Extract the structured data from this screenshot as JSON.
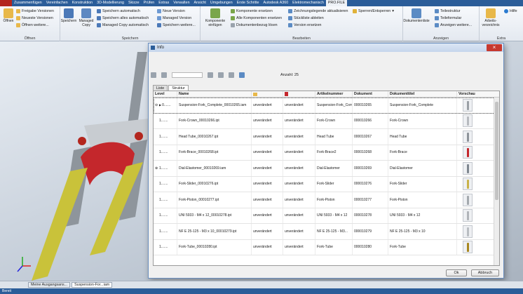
{
  "ribbon_tabs": [
    "Zusammenfügen",
    "Vereinfachen",
    "Konstruktion",
    "3D-Modellierung",
    "Skizze",
    "Prüfen",
    "Extras",
    "Verwalten",
    "Ansicht",
    "Umgebungen",
    "Erste Schritte",
    "Autodesk A360",
    "Elektromechanisch",
    "PRO.FILE"
  ],
  "active_tab_index": 13,
  "groups": {
    "oeffnen": {
      "label": "Öffnen",
      "big": "Öffnen",
      "small": [
        "Freigabe Versionen",
        "Neueste Versionen",
        "Öffnen weitere..."
      ]
    },
    "speichern": {
      "label": "Speichern",
      "big1": "Speichern",
      "big2": "Managed Copy",
      "col1": [
        "Speichern automatisch",
        "Speichern alles automatisch",
        "Managed Copy automatisch"
      ],
      "col2": [
        "Neue Version",
        "Managed Version",
        "Speichern weitere..."
      ]
    },
    "bearbeiten": {
      "label": "Bearbeiten",
      "big": "Komponente einfügen",
      "col1": [
        "Komponente ersetzen",
        "Alle Komponenten ersetzen",
        "Dokumentenbezug lösen"
      ],
      "col2": [
        "Zeichnungslegende aktualisieren",
        "Stückliste ableiten",
        "Version ersetzen"
      ],
      "lock": "Sperren/Entsperren"
    },
    "anzeigen": {
      "label": "Anzeigen",
      "big": "Dokumentenliste",
      "small": [
        "Teilestruktur",
        "Teileformular",
        "Anzeigen weitere..."
      ]
    },
    "extra": {
      "label": "Extra",
      "big": "Arbeits-verzeichnis",
      "help": "Hilfe"
    }
  },
  "dialog": {
    "title": "Info",
    "count_label": "Anzahl: 25",
    "tabs": [
      "Liste",
      "Struktur"
    ],
    "active_tab": 1,
    "columns": [
      "Level",
      "Name",
      "",
      "",
      "Artikelnummer",
      "Dokument",
      "Dokumenttitel",
      "Vorschau"
    ],
    "rows": [
      {
        "level": "0.......",
        "name": "Suspension-Fork_Complete_00010265.iam",
        "s1": "unverändert",
        "s2": "unverändert",
        "article": "Suspension-Fork_Complete",
        "doc": "000010265",
        "title": "Suspension-Fork_Complete",
        "thumb": "#9aa0a6",
        "expand": "collapse"
      },
      {
        "level": "1.......",
        "name": "Fork-Crown_00010266.ipt",
        "s1": "unverändert",
        "s2": "unverändert",
        "article": "Fork-Crown",
        "doc": "000010266",
        "title": "Fork-Crown",
        "thumb": "#b7babf",
        "expand": ""
      },
      {
        "level": "1.......",
        "name": "Head Tube_00010267.ipt",
        "s1": "unverändert",
        "s2": "unverändert",
        "article": "Head Tube",
        "doc": "000010267",
        "title": "Head Tube",
        "thumb": "#8d939a",
        "expand": ""
      },
      {
        "level": "1.......",
        "name": "Fork-Brace_00010268.ipt",
        "s1": "unverändert",
        "s2": "unverändert",
        "article": "Fork-Brace2",
        "doc": "000010268",
        "title": "Fork-Brace",
        "thumb": "#c4272c",
        "expand": ""
      },
      {
        "level": "1.......",
        "name": "Dial-Elastomer_00010269.iam",
        "s1": "unverändert",
        "s2": "unverändert",
        "article": "Dial-Elastomer",
        "doc": "000010269",
        "title": "Dial-Elastomer",
        "thumb": "#7f8790",
        "expand": "expand"
      },
      {
        "level": "1.......",
        "name": "Fork-Slider_00010276.ipt",
        "s1": "unverändert",
        "s2": "unverändert",
        "article": "Fork-Slider",
        "doc": "000010276",
        "title": "Fork-Slider",
        "thumb": "#c9b24a",
        "expand": ""
      },
      {
        "level": "1.......",
        "name": "Fork-Piston_00010277.ipt",
        "s1": "unverändert",
        "s2": "unverändert",
        "article": "Fork-Piston",
        "doc": "000010277",
        "title": "Fork-Piston",
        "thumb": "#a4a9ae",
        "expand": ""
      },
      {
        "level": "1.......",
        "name": "UNI 5933 - M4 x 12_00010278.ipt",
        "s1": "unverändert",
        "s2": "unverändert",
        "article": "UNI 5933 - M4 x 12",
        "doc": "000010278",
        "title": "UNI 5933 - M4 x 12",
        "thumb": "#b0b4b9",
        "expand": ""
      },
      {
        "level": "1.......",
        "name": "NF E 25-125 - M3 x 10_00010279.ipt",
        "s1": "unverändert",
        "s2": "unverändert",
        "article": "NF E 25-125 - M3...",
        "doc": "000010279",
        "title": "NF E 25-125 - M3 x 10",
        "thumb": "#b9bdc2",
        "expand": ""
      },
      {
        "level": "1.......",
        "name": "Fork-Tube_00010280.ipt",
        "s1": "unverändert",
        "s2": "unverändert",
        "article": "Fork-Tube",
        "doc": "000010280",
        "title": "Fork-Tube",
        "thumb": "#a8871f",
        "expand": ""
      }
    ],
    "ok": "Ok",
    "cancel": "Abbruch"
  },
  "doc_tabs": [
    "Meine Ausgangsans...",
    "Suspension-For...iam"
  ],
  "active_doc_tab": 1,
  "status": "Bereit",
  "colors": {
    "ribbon_blue": "#2b5d99",
    "fork_yellow": "#c9c23a",
    "fork_red": "#c4272c",
    "fork_gray": "#8e959c"
  }
}
